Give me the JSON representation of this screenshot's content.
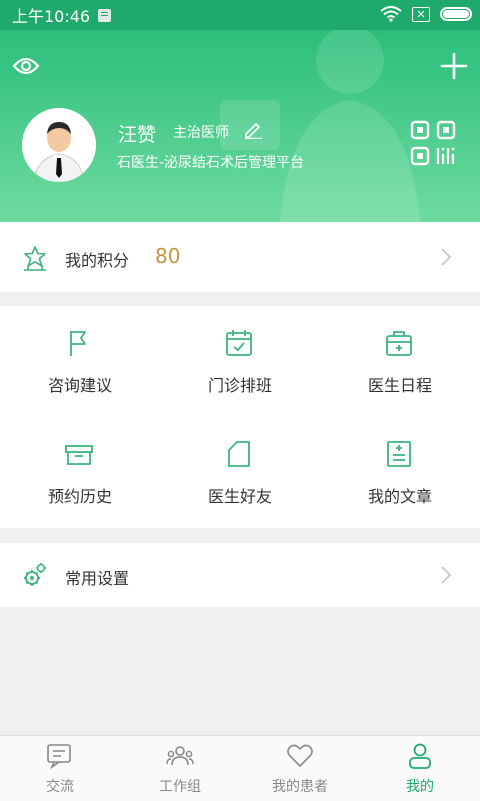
{
  "status_bar": {
    "time": "上午10:46",
    "sim_label": "✕"
  },
  "header": {
    "doctor_name": "汪赞",
    "doctor_title": "主治医师",
    "platform": "石医生-泌尿结石术后管理平台"
  },
  "points": {
    "label": "我的积分",
    "value": "80"
  },
  "grid": {
    "items": [
      {
        "label": "咨询建议",
        "icon": "flag-icon"
      },
      {
        "label": "门诊排班",
        "icon": "calendar-check-icon"
      },
      {
        "label": "医生日程",
        "icon": "medical-kit-icon"
      },
      {
        "label": "预约历史",
        "icon": "archive-box-icon"
      },
      {
        "label": "医生好友",
        "icon": "document-fold-icon"
      },
      {
        "label": "我的文章",
        "icon": "article-list-icon"
      }
    ]
  },
  "settings": {
    "label": "常用设置"
  },
  "tabbar": {
    "tabs": [
      {
        "label": "交流",
        "icon": "chat-icon"
      },
      {
        "label": "工作组",
        "icon": "group-icon"
      },
      {
        "label": "我的患者",
        "icon": "heart-icon"
      },
      {
        "label": "我的",
        "icon": "person-icon"
      }
    ],
    "active_index": 3
  },
  "colors": {
    "brand_green": "#1fa96a",
    "points_gold": "#c8953f",
    "icon_green": "#3bb57a"
  }
}
